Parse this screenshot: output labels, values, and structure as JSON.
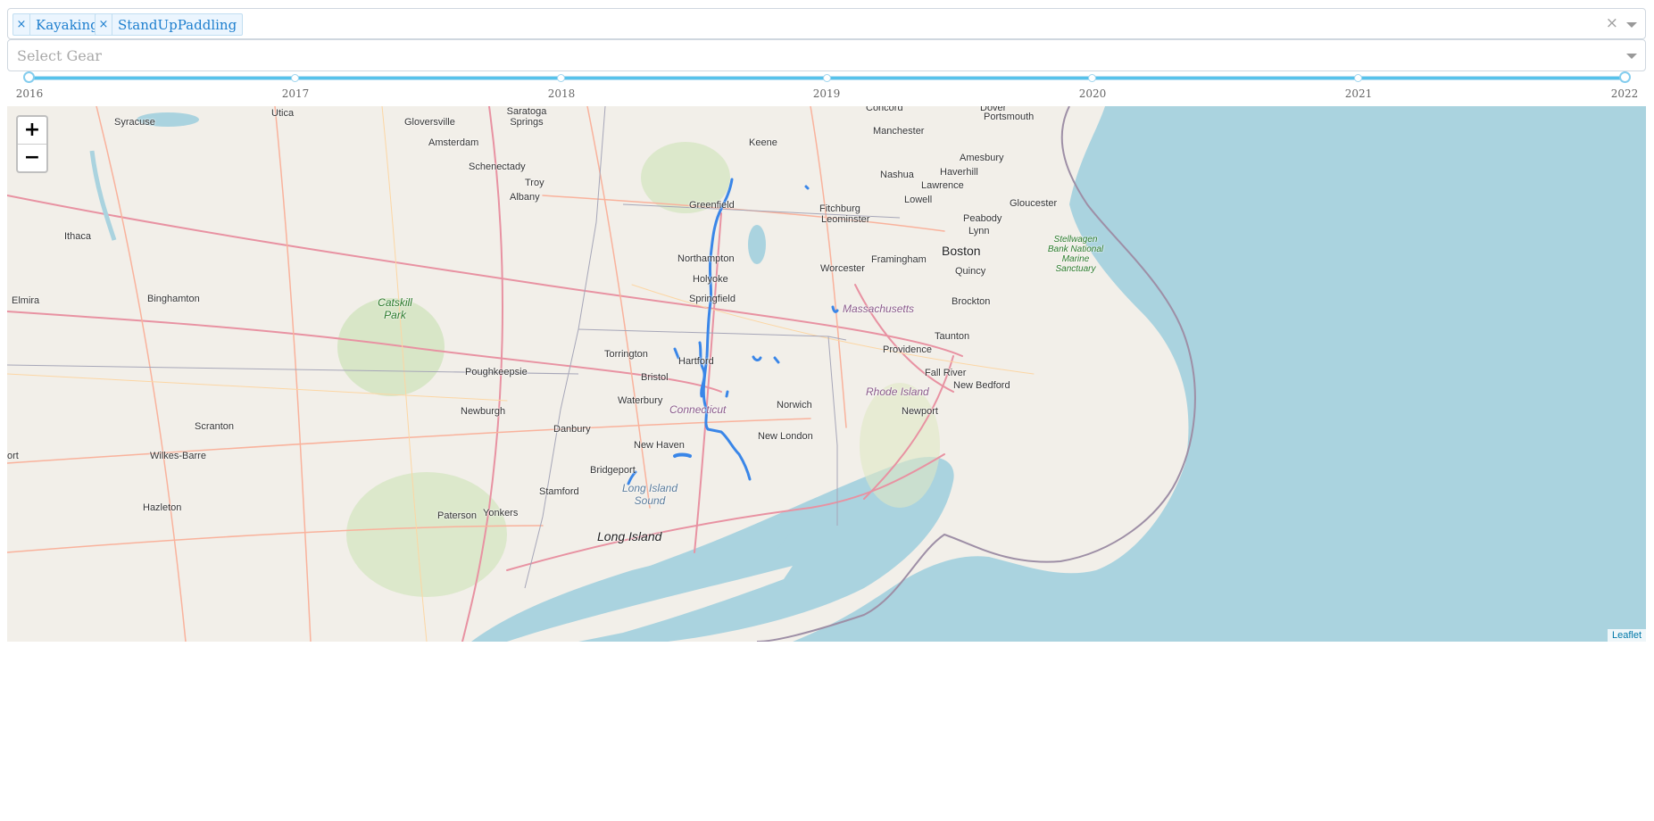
{
  "activity_filter": {
    "tags": [
      {
        "remove": "×",
        "label": "Kayaking"
      },
      {
        "remove": "×",
        "label": "StandUpPaddling"
      }
    ],
    "clear": "×"
  },
  "gear_filter": {
    "placeholder": "Select Gear"
  },
  "year_slider": {
    "min": 2016,
    "max": 2022,
    "selected_range": [
      2016,
      2022
    ],
    "marks": [
      "2016",
      "2017",
      "2018",
      "2019",
      "2020",
      "2021",
      "2022"
    ]
  },
  "map": {
    "zoom_in": "+",
    "zoom_out": "−",
    "attribution": "Leaflet",
    "route_color": "#3a86e8",
    "places": [
      {
        "name": "Syracuse"
      },
      {
        "name": "Utica"
      },
      {
        "name": "Gloversville"
      },
      {
        "name": "Saratoga Springs"
      },
      {
        "name": "Amsterdam"
      },
      {
        "name": "Schenectady"
      },
      {
        "name": "Troy"
      },
      {
        "name": "Albany"
      },
      {
        "name": "Ithaca"
      },
      {
        "name": "Elmira"
      },
      {
        "name": "Binghamton"
      },
      {
        "name": "Catskill Park"
      },
      {
        "name": "Poughkeepsie"
      },
      {
        "name": "Newburgh"
      },
      {
        "name": "Scranton"
      },
      {
        "name": "Wilkes-Barre"
      },
      {
        "name": "Hazleton"
      },
      {
        "name": "ort"
      },
      {
        "name": "Paterson"
      },
      {
        "name": "Yonkers"
      },
      {
        "name": "Stamford"
      },
      {
        "name": "Danbury"
      },
      {
        "name": "Bridgeport"
      },
      {
        "name": "New Haven"
      },
      {
        "name": "Waterbury"
      },
      {
        "name": "Bristol"
      },
      {
        "name": "Torrington"
      },
      {
        "name": "Hartford"
      },
      {
        "name": "Springfield"
      },
      {
        "name": "Holyoke"
      },
      {
        "name": "Northampton"
      },
      {
        "name": "Greenfield"
      },
      {
        "name": "Keene"
      },
      {
        "name": "Concord"
      },
      {
        "name": "Dover"
      },
      {
        "name": "Portsmouth"
      },
      {
        "name": "Manchester"
      },
      {
        "name": "Amesbury"
      },
      {
        "name": "Nashua"
      },
      {
        "name": "Haverhill"
      },
      {
        "name": "Lawrence"
      },
      {
        "name": "Lowell"
      },
      {
        "name": "Gloucester"
      },
      {
        "name": "Fitchburg"
      },
      {
        "name": "Leominster"
      },
      {
        "name": "Peabody"
      },
      {
        "name": "Lynn"
      },
      {
        "name": "Boston"
      },
      {
        "name": "Framingham"
      },
      {
        "name": "Worcester"
      },
      {
        "name": "Quincy"
      },
      {
        "name": "Brockton"
      },
      {
        "name": "Massachusetts"
      },
      {
        "name": "Taunton"
      },
      {
        "name": "Providence"
      },
      {
        "name": "Fall River"
      },
      {
        "name": "New Bedford"
      },
      {
        "name": "Rhode Island"
      },
      {
        "name": "Newport"
      },
      {
        "name": "Norwich"
      },
      {
        "name": "Connecticut"
      },
      {
        "name": "New London"
      },
      {
        "name": "Long Island Sound"
      },
      {
        "name": "Long Island"
      },
      {
        "name": "Stellwagen Bank National Marine Sanctuary"
      }
    ]
  }
}
